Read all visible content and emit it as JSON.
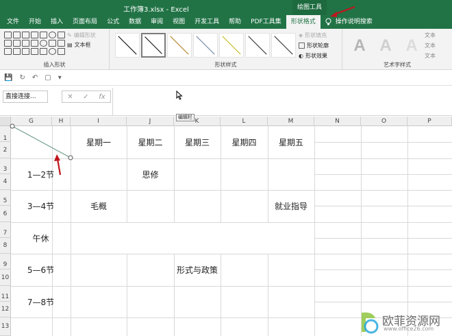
{
  "window": {
    "title": "工作簿3.xlsx  -  Excel",
    "context_tab_group": "绘图工具"
  },
  "tabs": [
    "文件",
    "开始",
    "插入",
    "页面布局",
    "公式",
    "数据",
    "审阅",
    "视图",
    "开发工具",
    "帮助",
    "PDF工具集",
    "形状格式"
  ],
  "active_tab": "形状格式",
  "tell_me": "操作说明搜索",
  "ribbon": {
    "insert_shapes": {
      "label": "插入形状",
      "edit_shape": "编辑形状",
      "text_box": "文本框"
    },
    "shape_styles": {
      "label": "形状样式",
      "fill": "形状填充",
      "outline": "形状轮廓",
      "effects": "形状效果"
    },
    "wordart": {
      "label": "艺术字样式",
      "letter": "A",
      "side": [
        "文本",
        "文本",
        "文本"
      ]
    }
  },
  "formula_bar": {
    "name_box": "直接连接...",
    "cancel": "✕",
    "enter": "✓",
    "fx": "fx",
    "tooltip": "编辑栏"
  },
  "columns": [
    "G",
    "H",
    "I",
    "J",
    "K",
    "L",
    "M",
    "N",
    "O",
    "P"
  ],
  "rows": [
    "1",
    "2",
    "3",
    "4",
    "5",
    "6",
    "7",
    "8",
    "9",
    "10",
    "11",
    "12",
    "13"
  ],
  "table": {
    "weekdays": [
      "星期一",
      "星期二",
      "星期三",
      "星期四",
      "星期五"
    ],
    "periods": [
      "1—2节",
      "3—4节",
      "午休",
      "5—6节",
      "7—8节"
    ],
    "entries": {
      "siwei": "思修",
      "maogai": "毛概",
      "jiuye": "就业指导",
      "xingshi": "形式与政策"
    }
  },
  "watermark": {
    "brand": "欧菲资源网",
    "url": "www.office26.com"
  },
  "colors": {
    "excel_green": "#217346",
    "arrow_red": "#c0161d",
    "shape_line": "#6a9a86"
  }
}
